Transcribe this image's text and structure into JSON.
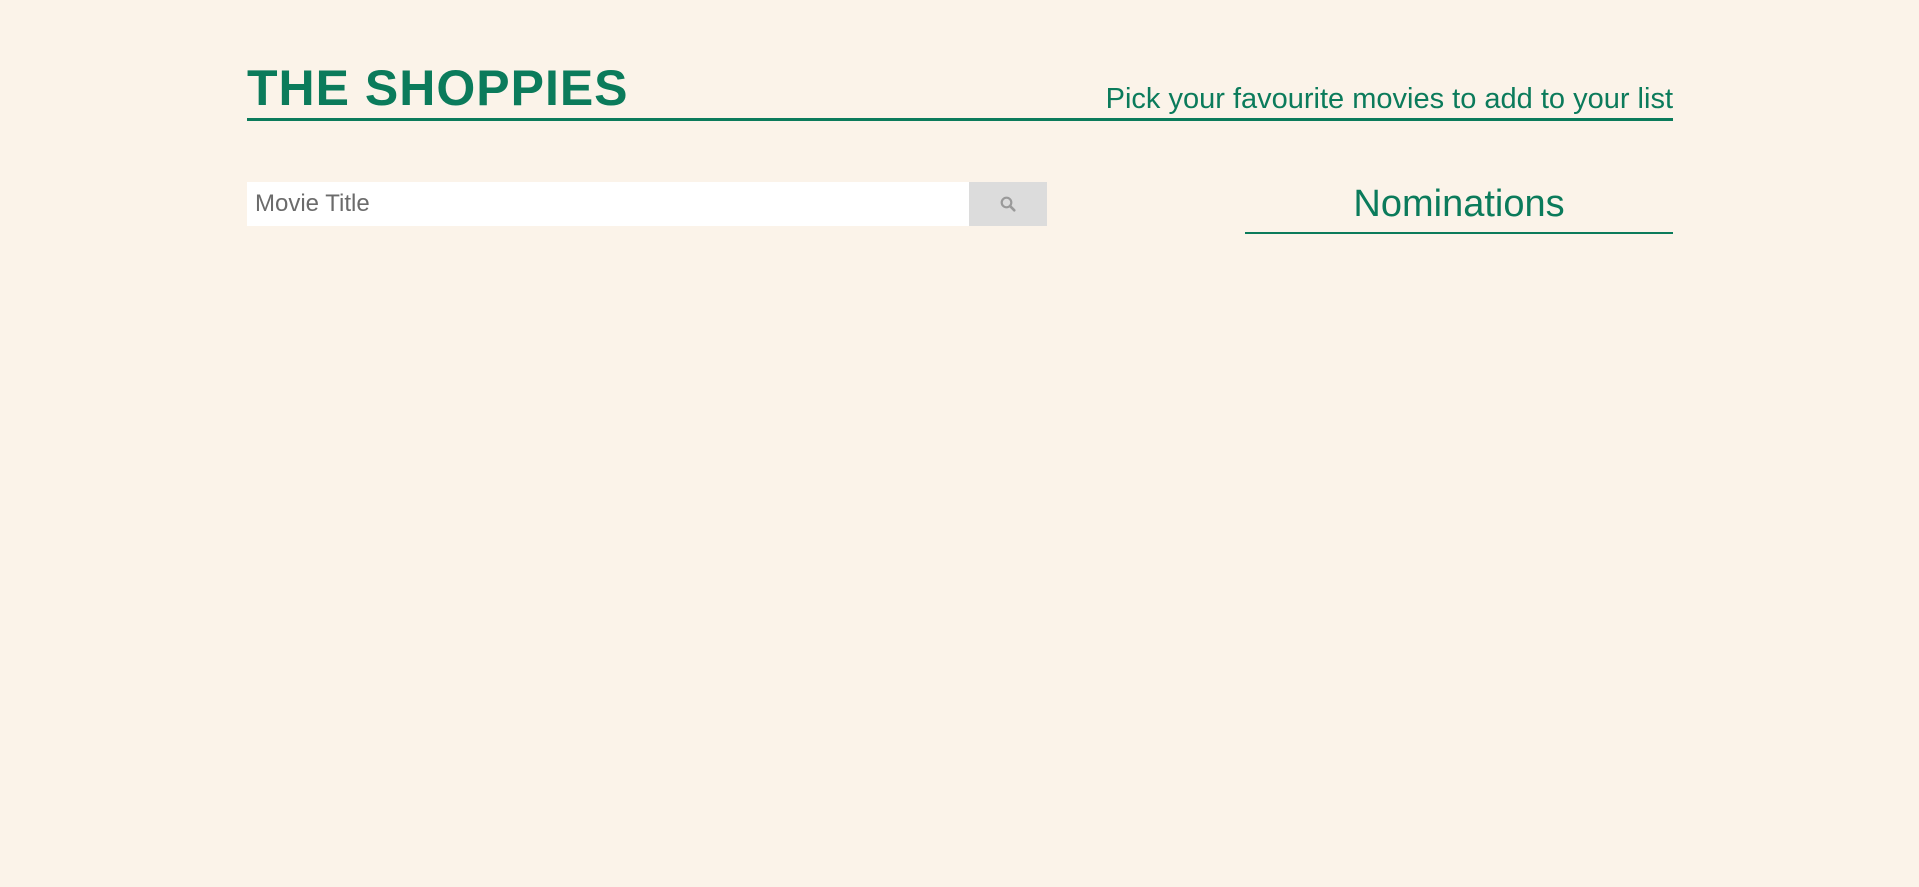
{
  "header": {
    "brand": "THE SHOPPIES",
    "tagline": "Pick your favourite movies to add to your list"
  },
  "search": {
    "placeholder": "Movie Title",
    "value": "",
    "button_icon": "search-icon"
  },
  "nominations": {
    "title": "Nominations",
    "items": []
  },
  "colors": {
    "background": "#fbf3e9",
    "accent": "#0b7b5b",
    "input_background": "#ffffff",
    "button_background": "#dcdcdc",
    "icon": "#9a9a9a"
  }
}
